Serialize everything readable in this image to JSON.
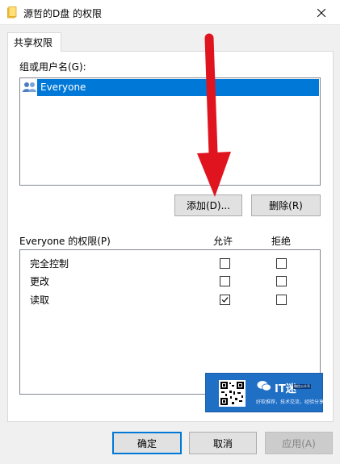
{
  "window": {
    "title": "源哲的D盘 的权限",
    "close_glyph": "✕"
  },
  "tab": {
    "label": "共享权限"
  },
  "groups": {
    "label": "组或用户名(G):",
    "items": [
      {
        "name": "Everyone",
        "selected": true
      }
    ]
  },
  "group_buttons": {
    "add": "添加(D)...",
    "remove": "删除(R)"
  },
  "permissions": {
    "label": "Everyone 的权限(P)",
    "allow_header": "允许",
    "deny_header": "拒绝",
    "rows": [
      {
        "name": "完全控制",
        "allow": false,
        "deny": false
      },
      {
        "name": "更改",
        "allow": false,
        "deny": false
      },
      {
        "name": "读取",
        "allow": true,
        "deny": false
      }
    ]
  },
  "dialog_buttons": {
    "ok": "确定",
    "cancel": "取消",
    "apply": "应用(A)"
  },
  "watermark": {
    "brand": "IT迷",
    "tag": "微信公众号",
    "slogan": "好软推荐，技术交流，经验分享"
  },
  "colors": {
    "selection": "#0078d7",
    "arrow": "#e0141e",
    "watermark_bg": "#1f6fc5"
  },
  "icons": {
    "title": "folder-icon",
    "user": "users-group-icon",
    "close": "close-icon"
  }
}
